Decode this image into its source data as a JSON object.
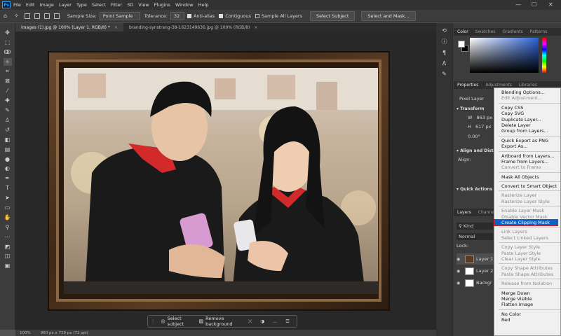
{
  "menubar": {
    "logo": "Ps",
    "items": [
      "File",
      "Edit",
      "Image",
      "Layer",
      "Type",
      "Select",
      "Filter",
      "3D",
      "View",
      "Plugins",
      "Window",
      "Help"
    ]
  },
  "options": {
    "sample_size_label": "Sample Size:",
    "sample_size_value": "Point Sample",
    "tolerance_label": "Tolerance:",
    "tolerance_value": "32",
    "anti_alias": "Anti-alias",
    "contiguous": "Contiguous",
    "sample_all_layers": "Sample All Layers",
    "select_subject": "Select Subject",
    "select_and_mask": "Select and Mask..."
  },
  "tabs": [
    {
      "label": "images (1).jpg @ 100% (Layer 1, RGB/8) *",
      "active": true
    },
    {
      "label": "branding-synstrang-38-1623149636.jpg @ 100% (RGB/8)",
      "active": false
    }
  ],
  "status": {
    "zoom": "100%",
    "doc": "960 px x 719 px (72 ppi)"
  },
  "contextual_bar": {
    "select_subject": "Select subject",
    "remove_background": "Remove background",
    "more": "..."
  },
  "panels": {
    "color_tabs": [
      "Color",
      "Swatches",
      "Gradients",
      "Patterns"
    ],
    "props_tabs": [
      "Properties",
      "Adjustments",
      "Libraries"
    ],
    "pixel_layer": "Pixel Layer",
    "transform": "Transform",
    "w_label": "W",
    "w_value": "863 px",
    "h_label": "H",
    "h_value": "617 px",
    "angle_value": "0.00°",
    "align_title": "Align and Distrib",
    "align_label": "Align:",
    "quick_actions": "Quick Actions",
    "layers_tabs": [
      "Layers",
      "Channels"
    ],
    "kind": "Kind",
    "blend": "Normal",
    "lock": "Lock:",
    "layers": [
      "Layer 1",
      "Layer 2",
      "Backgr"
    ]
  },
  "context_menu": [
    {
      "label": "Blending Options...",
      "state": "normal"
    },
    {
      "label": "Edit Adjustment...",
      "state": "disabled"
    },
    {
      "sep": true
    },
    {
      "label": "Copy CSS",
      "state": "normal"
    },
    {
      "label": "Copy SVG",
      "state": "normal"
    },
    {
      "label": "Duplicate Layer...",
      "state": "normal"
    },
    {
      "label": "Delete Layer",
      "state": "normal"
    },
    {
      "label": "Group from Layers...",
      "state": "normal"
    },
    {
      "sep": true
    },
    {
      "label": "Quick Export as PNG",
      "state": "normal"
    },
    {
      "label": "Export As...",
      "state": "normal"
    },
    {
      "sep": true
    },
    {
      "label": "Artboard from Layers...",
      "state": "normal"
    },
    {
      "label": "Frame from Layers...",
      "state": "normal"
    },
    {
      "label": "Convert to Frame",
      "state": "disabled"
    },
    {
      "sep": true
    },
    {
      "label": "Mask All Objects",
      "state": "normal"
    },
    {
      "sep": true
    },
    {
      "label": "Convert to Smart Object",
      "state": "normal"
    },
    {
      "sep": true
    },
    {
      "label": "Rasterize Layer",
      "state": "disabled"
    },
    {
      "label": "Rasterize Layer Style",
      "state": "disabled"
    },
    {
      "sep": true
    },
    {
      "label": "Enable Layer Mask",
      "state": "disabled"
    },
    {
      "label": "Disable Vector Mask",
      "state": "disabled"
    },
    {
      "label": "Create Clipping Mask",
      "state": "highlighted"
    },
    {
      "sep": true
    },
    {
      "label": "Link Layers",
      "state": "disabled"
    },
    {
      "label": "Select Linked Layers",
      "state": "disabled"
    },
    {
      "sep": true
    },
    {
      "label": "Copy Layer Style",
      "state": "disabled"
    },
    {
      "label": "Paste Layer Style",
      "state": "disabled"
    },
    {
      "label": "Clear Layer Style",
      "state": "disabled"
    },
    {
      "sep": true
    },
    {
      "label": "Copy Shape Attributes",
      "state": "disabled"
    },
    {
      "label": "Paste Shape Attributes",
      "state": "disabled"
    },
    {
      "sep": true
    },
    {
      "label": "Release from Isolation",
      "state": "disabled"
    },
    {
      "sep": true
    },
    {
      "label": "Merge Down",
      "state": "normal"
    },
    {
      "label": "Merge Visible",
      "state": "normal"
    },
    {
      "label": "Flatten Image",
      "state": "normal"
    },
    {
      "sep": true
    },
    {
      "label": "No Color",
      "state": "normal"
    },
    {
      "label": "Red",
      "state": "normal"
    }
  ],
  "colors": {
    "accent": "#0e62c4",
    "highlight_outline": "#e01e1e",
    "shirt": "#1a1a1a",
    "collar": "#d22a2a"
  }
}
